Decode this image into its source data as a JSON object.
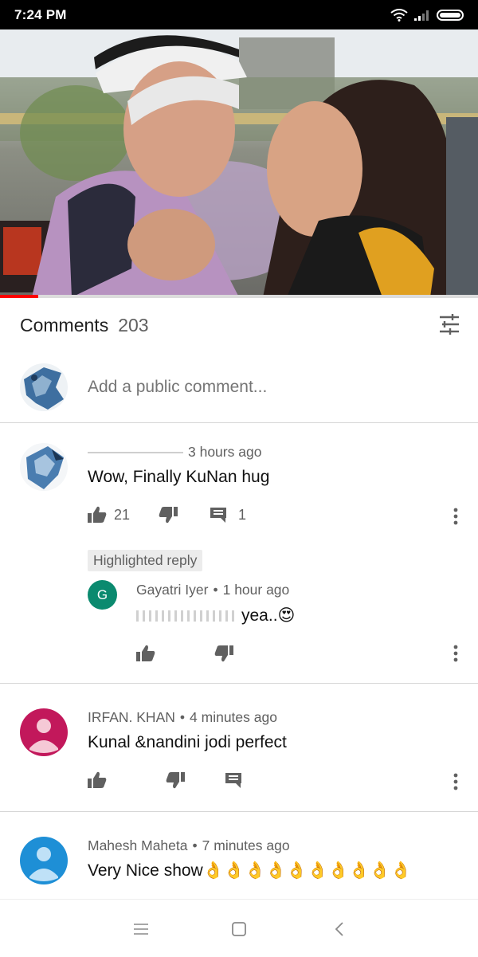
{
  "status_bar": {
    "time": "7:24 PM"
  },
  "video": {
    "progress": 0.08
  },
  "comments": {
    "label": "Comments",
    "count": "203",
    "add_placeholder": "Add a public comment..."
  },
  "thread1": {
    "time": "3 hours ago",
    "text": "Wow, Finally KuNan hug",
    "likes": "21",
    "replies": "1",
    "highlight_label": "Highlighted reply",
    "reply": {
      "avatar_letter": "G",
      "author": "Gayatri Iyer",
      "time": "1 hour ago",
      "text": "yea..😍"
    }
  },
  "thread2": {
    "author": "IRFAN. KHAN",
    "time": "4 minutes ago",
    "text": "Kunal &nandini jodi perfect"
  },
  "thread3": {
    "author": "Mahesh Maheta",
    "time": "7 minutes ago",
    "text": "Very Nice show👌👌👌👌👌👌👌👌👌👌"
  },
  "colors": {
    "accent_red": "#ff0000",
    "avatar_pink": "#c2185b",
    "avatar_blue": "#1e8fd6",
    "avatar_green": "#0b8a6f"
  }
}
